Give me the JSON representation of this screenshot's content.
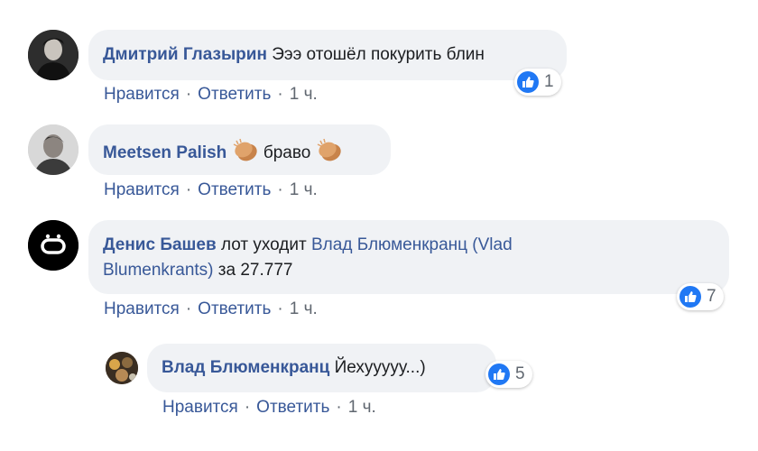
{
  "comments": [
    {
      "author": "Дмитрий Глазырин",
      "text": "Эээ отошёл покурить блин",
      "reaction_count": "1",
      "actions": {
        "like": "Нравится",
        "reply": "Ответить",
        "time": "1 ч."
      }
    },
    {
      "author": "Meetsen Palish",
      "text": "браво",
      "emoji_icon": "clapping-hands-icon",
      "actions": {
        "like": "Нравится",
        "reply": "Ответить",
        "time": "1 ч."
      }
    },
    {
      "author": "Денис Башев",
      "text_before": "лот уходит",
      "mention_line1": "Влад Блюменкранц (Vlad",
      "mention_line2": "Blumenkrants)",
      "text_after": "за 27.777",
      "reaction_count": "7",
      "actions": {
        "like": "Нравится",
        "reply": "Ответить",
        "time": "1 ч."
      }
    },
    {
      "author": "Влад Блюменкранц",
      "text": "Йехууууу...)",
      "reaction_count": "5",
      "actions": {
        "like": "Нравится",
        "reply": "Ответить",
        "time": "1 ч."
      }
    }
  ],
  "separator": "·",
  "colors": {
    "link": "#385898",
    "bubble": "#f0f2f5",
    "meta": "#606770",
    "like": "#2078f4"
  }
}
